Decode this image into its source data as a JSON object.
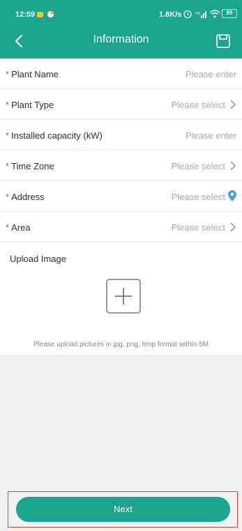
{
  "status_bar": {
    "time": "12:59",
    "speed": "1.8K/s",
    "battery": "89"
  },
  "header": {
    "title": "Information",
    "background": "#1ba58d"
  },
  "form": {
    "fields": [
      {
        "label": "Plant Name",
        "required": true,
        "placeholder": "Please enter",
        "icon": ""
      },
      {
        "label": "Plant Type",
        "required": true,
        "placeholder": "Please select",
        "icon": "chevron-right-icon"
      },
      {
        "label": "Installed capacity (kW)",
        "required": true,
        "placeholder": "Please enter",
        "icon": ""
      },
      {
        "label": "Time Zone",
        "required": true,
        "placeholder": "Please select",
        "icon": "chevron-right-icon"
      },
      {
        "label": "Address",
        "required": true,
        "placeholder": "Please select",
        "icon": "location-pin-icon"
      },
      {
        "label": "Area",
        "required": true,
        "placeholder": "Please select",
        "icon": "chevron-right-icon"
      }
    ],
    "upload": {
      "label": "Upload Image",
      "hint": "Please upload pictures in jpg, png, bmp format within 5M"
    }
  },
  "footer": {
    "next_label": "Next"
  },
  "colors": {
    "accent": "#1ba58d",
    "required": "#e04b4b",
    "placeholder": "#aaaaaa",
    "pin": "#3aa7d8"
  }
}
